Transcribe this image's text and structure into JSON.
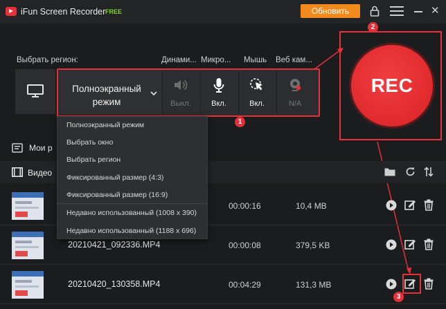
{
  "window": {
    "app_name": "iFun Screen Recorder",
    "edition": "FREE",
    "update_label": "Обновить"
  },
  "toolbar": {
    "region_label": "Выбрать регион:",
    "dynamics_label": "Динами...",
    "mic_label": "Микро...",
    "mouse_label": "Мышь",
    "webcam_label": "Веб кам...",
    "mode_line1": "Полноэкранный",
    "mode_line2": "режим",
    "speaker_state": "Выкл.",
    "mic_state": "Вкл.",
    "mouse_state": "Вкл.",
    "webcam_state": "N/A"
  },
  "record": {
    "label": "REC"
  },
  "dropdown": {
    "items": [
      "Полноэкранный режим",
      "Выбрать окно",
      "Выбрать регион",
      "Фиксированный размер (4:3)",
      "Фиксированный размер (16:9)",
      "Недавно использованный (1008 x 390)",
      "Недавно использованный (1188 x 696)"
    ]
  },
  "library": {
    "my_recordings_label": "Мои р",
    "videos_label": "Видео",
    "files": [
      {
        "name": "",
        "duration": "00:00:16",
        "size": "10,4 MB"
      },
      {
        "name": "20210421_092336.MP4",
        "duration": "00:00:08",
        "size": "379,5 KB"
      },
      {
        "name": "20210420_130358.MP4",
        "duration": "00:04:29",
        "size": "131,3 MB"
      }
    ]
  },
  "annotations": {
    "badge1": "1",
    "badge2": "2",
    "badge3": "3"
  },
  "colors": {
    "accent": "#e8303a",
    "update": "#f08a1c",
    "free": "#7fd321",
    "background": "#1b1c1e"
  }
}
